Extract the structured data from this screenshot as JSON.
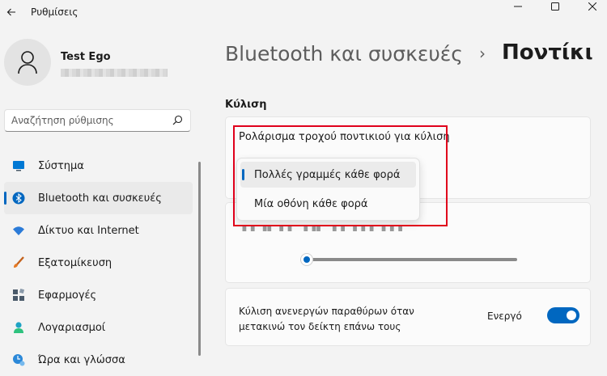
{
  "app": {
    "title": "Ρυθμίσεις"
  },
  "user": {
    "name": "Test Ego"
  },
  "search": {
    "placeholder": "Αναζήτηση ρύθμισης"
  },
  "sidebar": {
    "items": [
      {
        "label": "Σύστημα",
        "icon": "system-icon",
        "color": "#0078d4"
      },
      {
        "label": "Bluetooth και συσκευές",
        "icon": "bluetooth-icon",
        "color": "#0067c0",
        "active": true
      },
      {
        "label": "Δίκτυο και Internet",
        "icon": "wifi-icon",
        "color": "#2b7bd8"
      },
      {
        "label": "Εξατομίκευση",
        "icon": "brush-icon",
        "color": "#e57a25"
      },
      {
        "label": "Εφαρμογές",
        "icon": "apps-icon",
        "color": "#4a5a6a"
      },
      {
        "label": "Λογαριασμοί",
        "icon": "account-icon",
        "color": "#1fa3c4"
      },
      {
        "label": "Ώρα και γλώσσα",
        "icon": "time-language-icon",
        "color": "#2b88d8"
      }
    ]
  },
  "breadcrumb": {
    "parent": "Bluetooth και συσκευές",
    "separator": "›",
    "current": "Ποντίκι"
  },
  "section": {
    "title": "Κύλιση"
  },
  "wheel_scroll": {
    "label": "Ρολάρισμα τροχού ποντικιού για κύλιση",
    "options": [
      "Πολλές γραμμές κάθε φορά",
      "Μία οθόνη κάθε φορά"
    ],
    "selected": "Πολλές γραμμές κάθε φορά"
  },
  "lines_slider": {
    "value": 0.03
  },
  "inactive_scroll": {
    "label": "Κύλιση ανενεργών παραθύρων όταν μετακινώ τον δείκτη επάνω τους",
    "state": "Ενεργό",
    "on": true
  },
  "colors": {
    "accent": "#0067c0",
    "highlight": "#e0001b"
  }
}
